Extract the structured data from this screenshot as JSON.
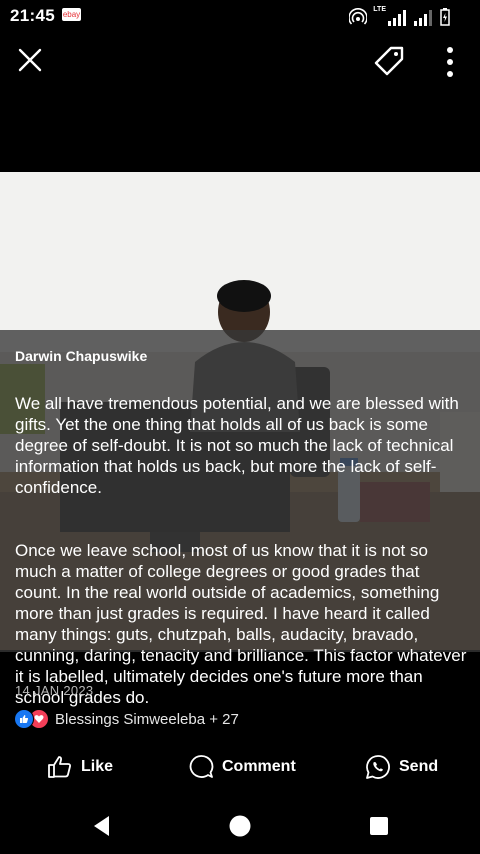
{
  "status_bar": {
    "time": "21:45",
    "app_badge": "ebay",
    "network": "LTE"
  },
  "post": {
    "author": "Darwin Chapuswike",
    "paragraphs": [
      "We all have tremendous potential, and we are blessed with gifts. Yet the one thing that holds all of us back is some degree of self-doubt. It is not so much the lack of technical information that holds us back, but more the lack of self-confidence.",
      "Once we leave school, most of us know that it is not so much a matter of college degrees or good grades that count. In the real world outside of academics, something more than just grades is required. I have heard it called many things: guts, chutzpah, balls, audacity, bravado, cunning, daring, tenacity and brilliance. This factor whatever it is labelled, ultimately decides one's future more than school grades do."
    ],
    "date": "14 JAN 2023",
    "reactions_text": "Blessings Simweeleba + 27"
  },
  "actions": {
    "like": "Like",
    "comment": "Comment",
    "send": "Send"
  },
  "icons": {
    "close": "close-icon",
    "tag": "tag-icon",
    "more": "more-vertical-icon",
    "like": "thumbs-up-icon",
    "comment": "comment-bubble-icon",
    "send": "whatsapp-icon",
    "back": "back-triangle-icon",
    "home": "home-circle-icon",
    "recents": "recents-square-icon"
  },
  "colors": {
    "like_reaction": "#1877f2",
    "love_reaction": "#f33e58",
    "ebay_red": "#e53238"
  }
}
